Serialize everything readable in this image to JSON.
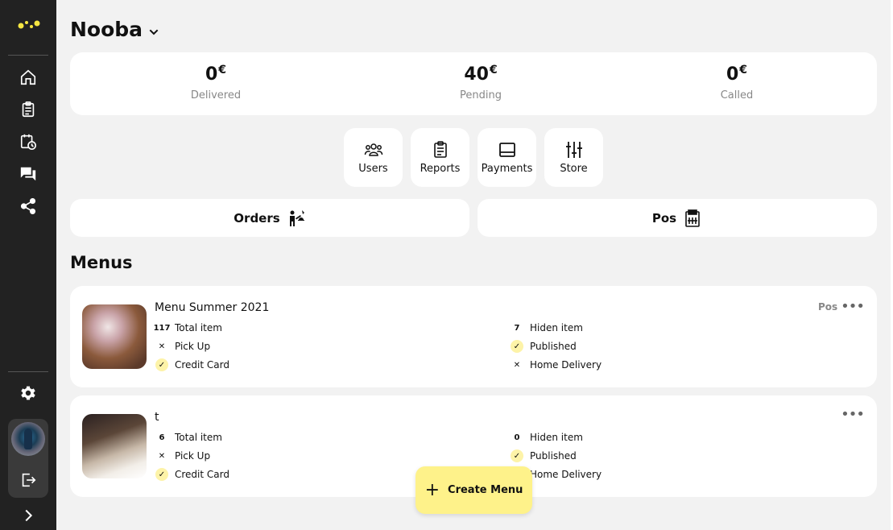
{
  "sidebar": {
    "nav": [
      "home-icon",
      "clipboard-icon",
      "calendar-clock-icon",
      "chat-icon",
      "share-icon"
    ],
    "bottom": [
      "settings-icon",
      "avatar",
      "logout-icon",
      "chevron-right-icon"
    ]
  },
  "header": {
    "store_name": "Nooba"
  },
  "stats": [
    {
      "value": "0",
      "currency": "€",
      "label": "Delivered"
    },
    {
      "value": "40",
      "currency": "€",
      "label": "Pending"
    },
    {
      "value": "0",
      "currency": "€",
      "label": "Called"
    }
  ],
  "actions": [
    {
      "label": "Users",
      "icon": "users-icon"
    },
    {
      "label": "Reports",
      "icon": "clipboard-icon"
    },
    {
      "label": "Payments",
      "icon": "card-icon"
    },
    {
      "label": "Store",
      "icon": "sliders-icon"
    }
  ],
  "big_buttons": {
    "orders": "Orders",
    "pos": "Pos"
  },
  "menus_title": "Menus",
  "menus": [
    {
      "name": "Menu Summer 2021",
      "pos_label": "Pos",
      "total_item": "117",
      "total_item_label": "Total item",
      "hidden_item": "7",
      "hidden_item_label": "Hiden item",
      "pickup_label": "Pick Up",
      "pickup": false,
      "published_label": "Published",
      "published": true,
      "credit_label": "Credit Card",
      "credit": true,
      "delivery_label": "Home Delivery",
      "delivery": false
    },
    {
      "name": "t",
      "pos_label": "",
      "total_item": "6",
      "total_item_label": "Total item",
      "hidden_item": "0",
      "hidden_item_label": "Hiden item",
      "pickup_label": "Pick Up",
      "pickup": false,
      "published_label": "Published",
      "published": true,
      "credit_label": "Credit Card",
      "credit": true,
      "delivery_label": "Home Delivery",
      "delivery": false
    }
  ],
  "create_menu_label": "Create Menu",
  "colors": {
    "sidebar": "#222222",
    "accent_yellow": "#fef28a",
    "check_bg": "#fdf3a8"
  }
}
